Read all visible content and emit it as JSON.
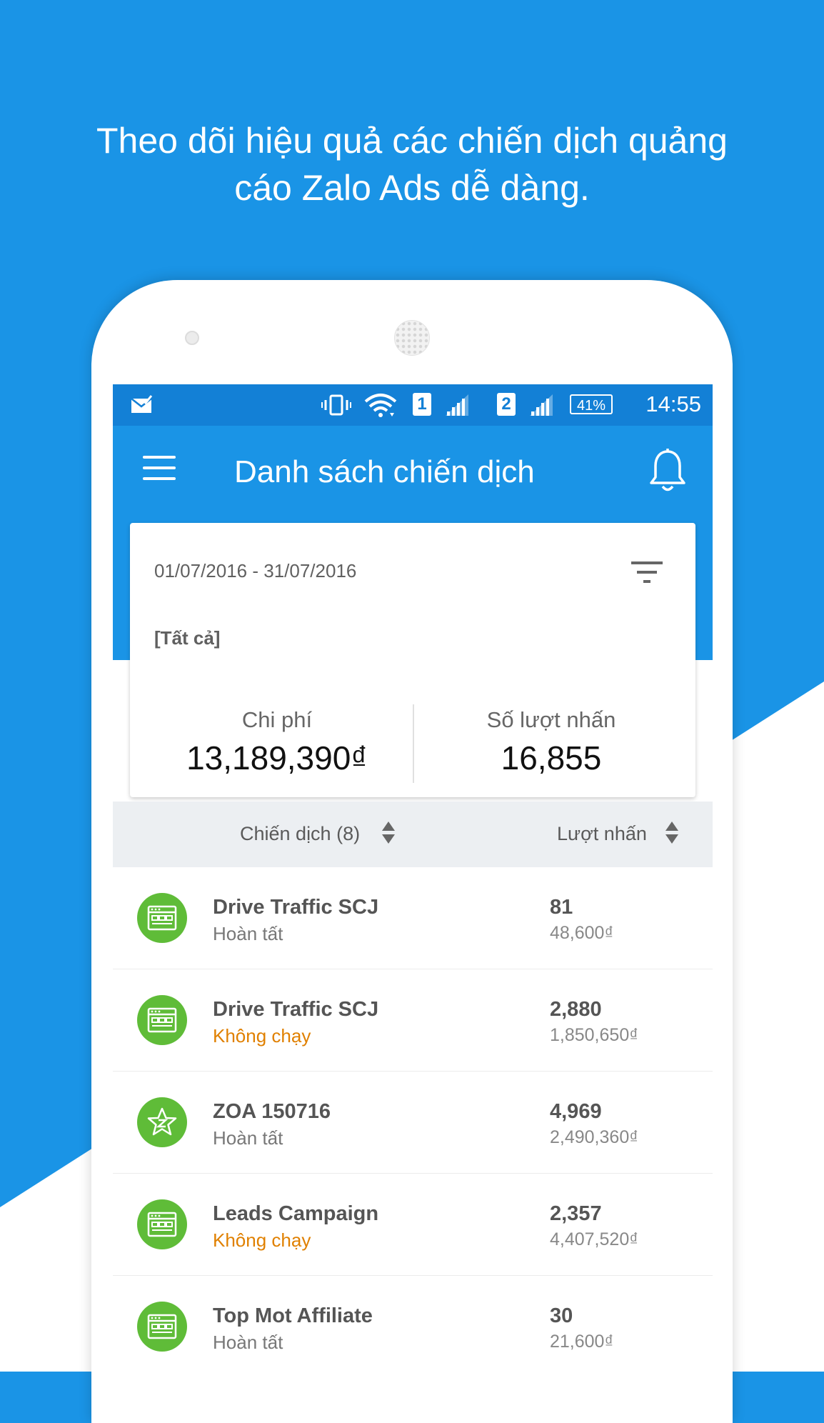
{
  "promo": {
    "line1": "Theo dõi hiệu quả các chiến dịch quảng",
    "line2": "cáo Zalo Ads dễ dàng."
  },
  "statusbar": {
    "sim1": "1",
    "sim2": "2",
    "battery": "41%",
    "time": "14:55"
  },
  "appbar": {
    "title": "Danh sách chiến dịch"
  },
  "summary": {
    "date_range": "01/07/2016 - 31/07/2016",
    "scope": "[Tất cả]",
    "cost_label": "Chi phí",
    "cost_value": "13,189,390₫",
    "clicks_label": "Số lượt nhấn",
    "clicks_value": "16,855"
  },
  "sort_bar": {
    "left_label": "Chiến dịch (8)",
    "right_label": "Lượt nhấn"
  },
  "campaigns": [
    {
      "name": "Drive Traffic SCJ",
      "status": "Hoàn tất",
      "clicks": "81",
      "cost": "48,600₫",
      "icon": "web-icon",
      "status_color": "#777777"
    },
    {
      "name": "Drive Traffic SCJ",
      "status": "Không chạy",
      "clicks": "2,880",
      "cost": "1,850,650₫",
      "icon": "web-icon",
      "status_color": "#e08000"
    },
    {
      "name": "ZOA 150716",
      "status": "Hoàn tất",
      "clicks": "4,969",
      "cost": "2,490,360₫",
      "icon": "zalo-star-icon",
      "status_color": "#777777"
    },
    {
      "name": "Leads Campaign",
      "status": "Không chạy",
      "clicks": "2,357",
      "cost": "4,407,520₫",
      "icon": "web-icon",
      "status_color": "#e08000"
    },
    {
      "name": "Top Mot Affiliate",
      "status": "Hoàn tất",
      "clicks": "30",
      "cost": "21,600₫",
      "icon": "web-icon",
      "status_color": "#777777"
    }
  ],
  "colors": {
    "brand_blue": "#1a94e6",
    "status_blue": "#1380d6",
    "avatar_green": "#5fbc38",
    "paused_orange": "#e08000"
  }
}
